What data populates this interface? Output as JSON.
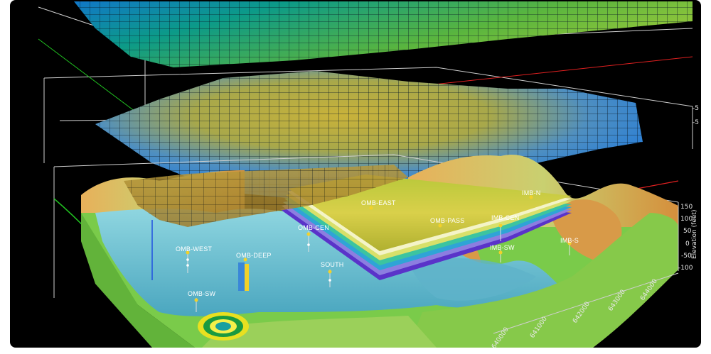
{
  "wells": [
    {
      "id": "omb-west",
      "label": "OMB-WEST"
    },
    {
      "id": "omb-deep",
      "label": "OMB-DEEP"
    },
    {
      "id": "omb-cen",
      "label": "OMB-CEN"
    },
    {
      "id": "omb-east",
      "label": "OMB-EAST"
    },
    {
      "id": "omb-pass",
      "label": "OMB-PASS"
    },
    {
      "id": "imb-cen",
      "label": "IMB-CEN"
    },
    {
      "id": "imb-n",
      "label": "IMB-N"
    },
    {
      "id": "imb-sw",
      "label": "IMB-SW"
    },
    {
      "id": "imb-s",
      "label": "IMB-S"
    },
    {
      "id": "south",
      "label": "SOUTH"
    },
    {
      "id": "omb-sw",
      "label": "OMB-SW"
    }
  ],
  "elevation_axis": {
    "title": "Elevation (feet)",
    "ticks": [
      "150",
      "100",
      "50",
      "0",
      "-50",
      "-100"
    ]
  },
  "easting_axis": {
    "ticks": [
      "640000",
      "641000",
      "642000",
      "643000",
      "644000"
    ]
  },
  "top_axis_partial_ticks": [
    "-5",
    "-5"
  ],
  "colors": {
    "background": "#000000",
    "grid_line": "#1b2a3a",
    "top_surface_left": "#0a9a78",
    "top_surface_right": "#8cc43a",
    "mid_surface_blue": "#2f8fd8",
    "mid_surface_yellow": "#b9a83a",
    "terrain_green": "#78c94a",
    "terrain_orange": "#e39a40",
    "water_cyan": "#6fc6d6",
    "box_edge_white": "#d0d0d0",
    "box_edge_red": "#e02020",
    "box_edge_green": "#20c020"
  }
}
